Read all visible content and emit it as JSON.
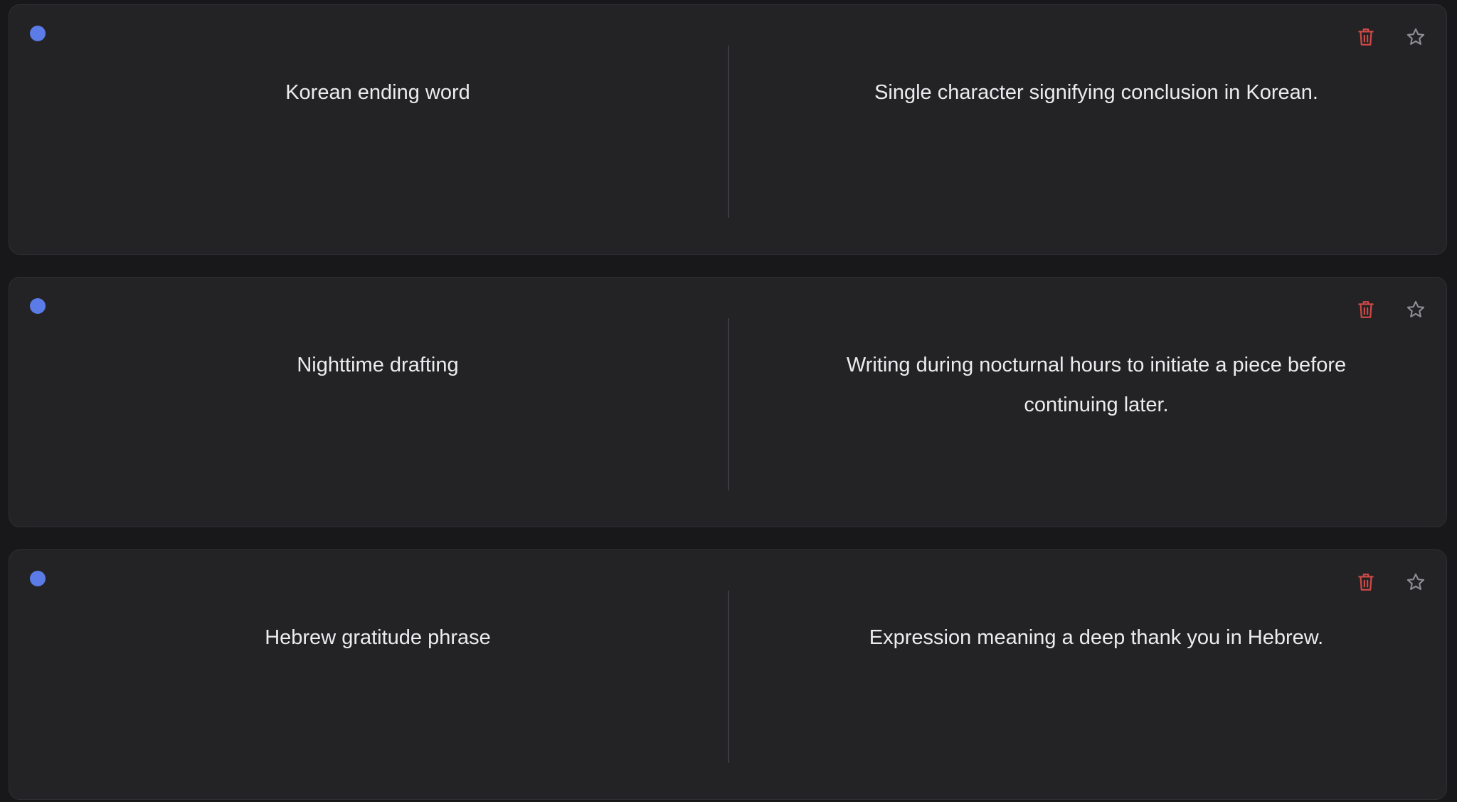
{
  "colors": {
    "background": "#18181a",
    "card": "#232326",
    "dot": "#5b7be6",
    "delete": "#d24a45",
    "star": "#8e8e94",
    "text": "#ececef"
  },
  "icons": {
    "status": "status-dot-icon",
    "delete": "trash-icon",
    "favorite": "star-outline-icon"
  },
  "cards": [
    {
      "term": "Korean ending word",
      "definition": "Single character signifying conclusion in Korean."
    },
    {
      "term": "Nighttime drafting",
      "definition": "Writing during nocturnal hours to initiate a piece before continuing later."
    },
    {
      "term": "Hebrew gratitude phrase",
      "definition": "Expression meaning a deep thank you in Hebrew."
    }
  ]
}
